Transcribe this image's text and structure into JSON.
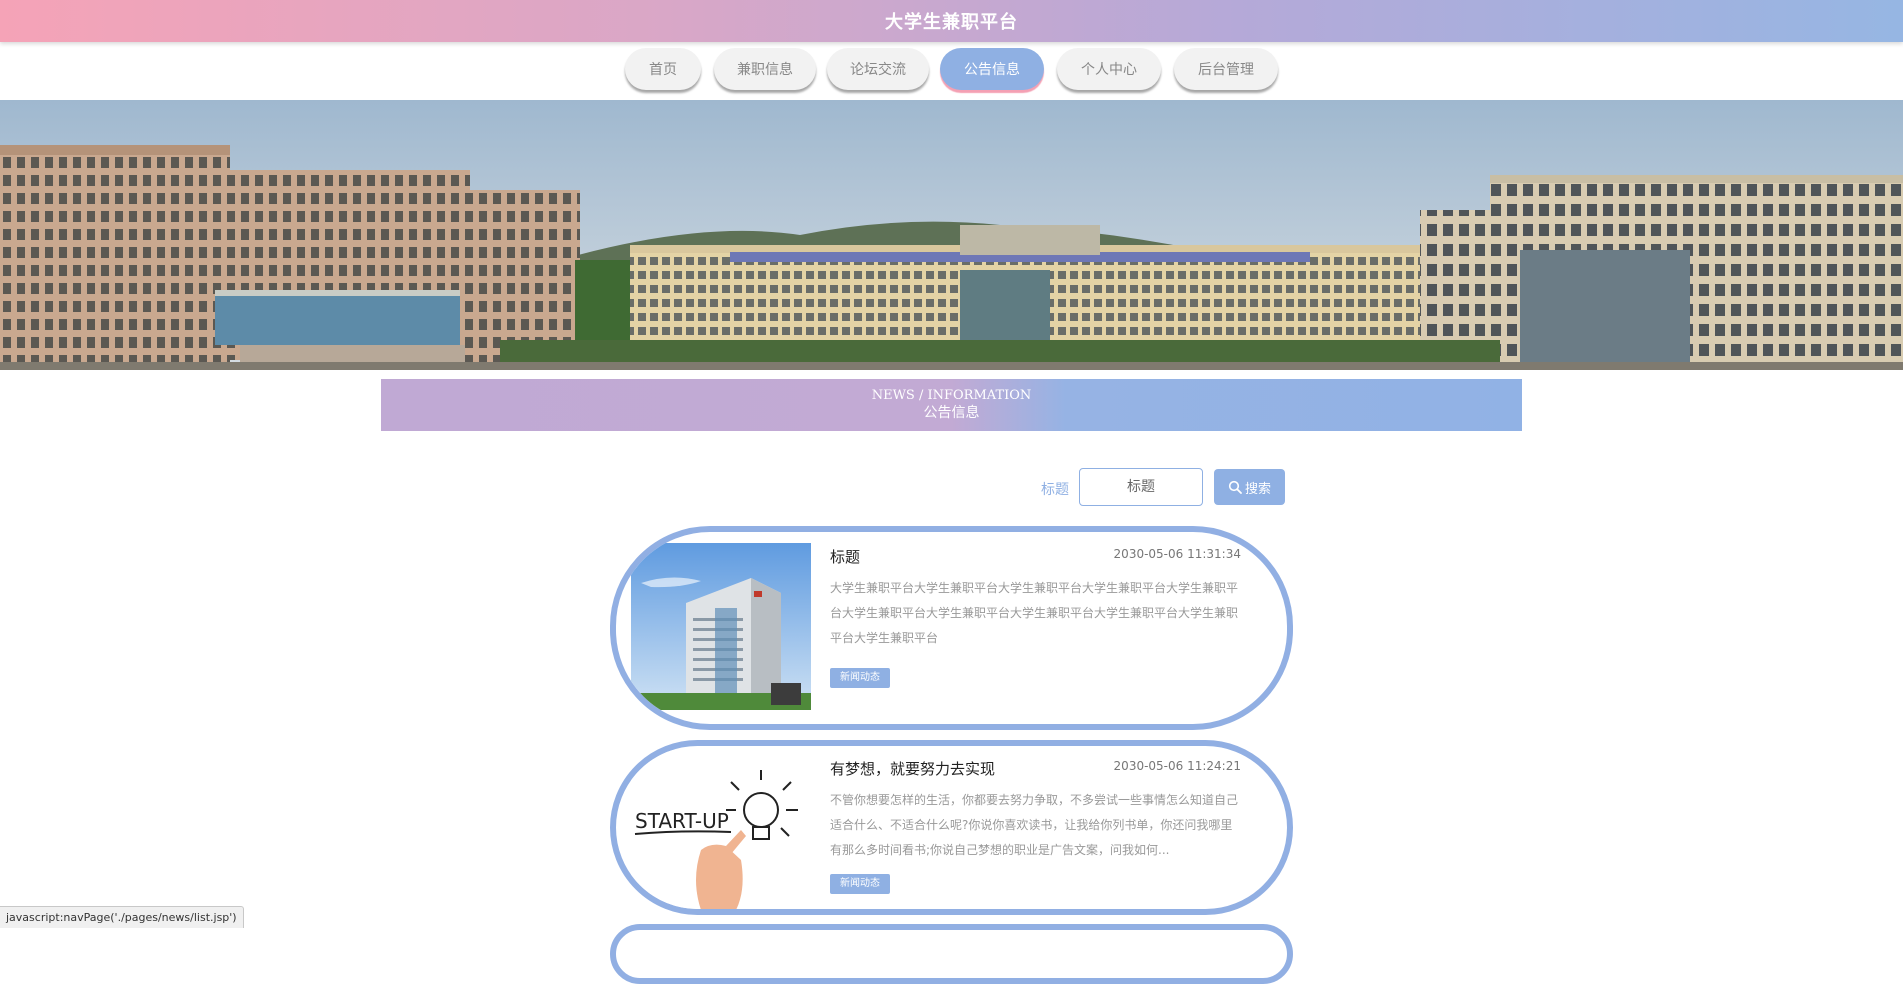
{
  "header": {
    "title": "大学生兼职平台"
  },
  "nav": {
    "items": [
      {
        "label": "首页"
      },
      {
        "label": "兼职信息"
      },
      {
        "label": "论坛交流"
      },
      {
        "label": "公告信息"
      },
      {
        "label": "个人中心"
      },
      {
        "label": "后台管理"
      }
    ],
    "active": "公告信息"
  },
  "section": {
    "title_en": "NEWS / INFORMATION",
    "title_cn": "公告信息"
  },
  "search": {
    "label": "标题",
    "placeholder": "标题",
    "button_label": "搜索"
  },
  "news": [
    {
      "title": "标题",
      "time": "2030-05-06 11:31:34",
      "summary": "大学生兼职平台大学生兼职平台大学生兼职平台大学生兼职平台大学生兼职平台大学生兼职平台大学生兼职平台大学生兼职平台大学生兼职平台大学生兼职平台大学生兼职平台",
      "tag": "新闻动态"
    },
    {
      "title": "有梦想，就要努力去实现",
      "time": "2030-05-06 11:24:21",
      "summary": "不管你想要怎样的生活，你都要去努力争取，不多尝试一些事情怎么知道自己适合什么、不适合什么呢?你说你喜欢读书，让我给你列书单，你还问我哪里有那么多时间看书;你说自己梦想的职业是广告文案，问我如何...",
      "tag": "新闻动态",
      "image_text": "START-UP"
    }
  ],
  "statusbar": {
    "text": "javascript:navPage('./pages/news/list.jsp')"
  },
  "colors": {
    "accent": "#8fb0e3",
    "pink": "#f5a3b7",
    "lavender": "#c0a9d4"
  }
}
